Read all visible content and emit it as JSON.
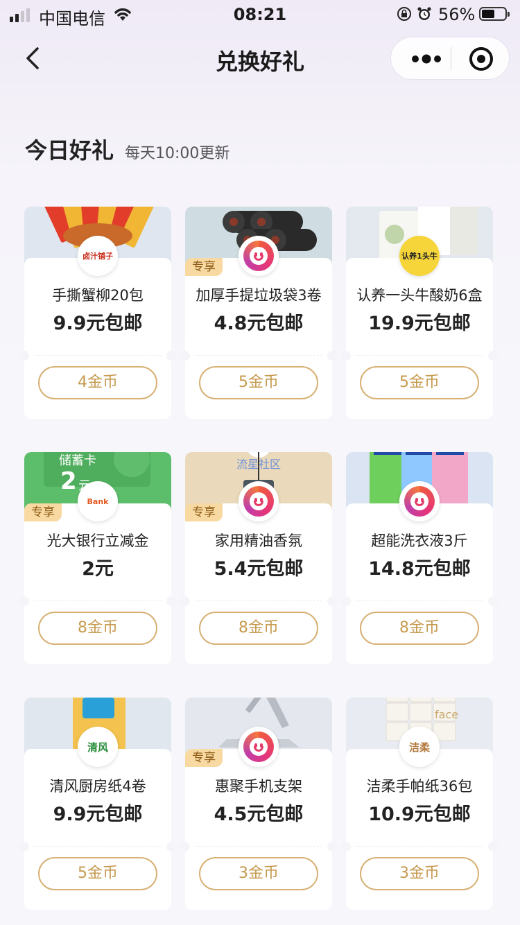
{
  "status_bar": {
    "carrier": "中国电信",
    "time": "08:21",
    "battery": "56%",
    "battery_level": 0.56
  },
  "nav": {
    "title": "兑换好礼"
  },
  "section": {
    "title": "今日好礼",
    "subtitle": "每天10:00更新"
  },
  "products": [
    {
      "name": "手撕蟹柳20包",
      "price": "9.9元包邮",
      "coins": "4金币",
      "badge": "",
      "bg": "#dfe6ef",
      "logo": "lujiangfu-brand-logo",
      "logo_text": "卤汁铺子"
    },
    {
      "name": "加厚手提垃圾袋3卷",
      "price": "4.8元包邮",
      "coins": "5金币",
      "badge": "专享",
      "bg": "#cfdde2",
      "logo": "huiju-logo"
    },
    {
      "name": "认养一头牛酸奶6盒",
      "price": "19.9元包邮",
      "coins": "5金币",
      "badge": "",
      "bg": "#e4e8ef",
      "logo": "renyang-cow-logo",
      "logo_text": "认养1头牛"
    },
    {
      "name": "光大银行立减金",
      "price": "2元",
      "coins": "8金币",
      "badge": "专享",
      "bg": "#5cbd6b",
      "logo": "bank-logo",
      "logo_text": "Bank",
      "voucher_label": "储蓄卡",
      "voucher_amount": "2",
      "voucher_unit": "元"
    },
    {
      "name": "家用精油香氛",
      "price": "5.4元包邮",
      "coins": "8金币",
      "badge": "专享",
      "bg": "#ead9bb",
      "logo": "huiju-logo",
      "overlay_text": "流星社区"
    },
    {
      "name": "超能洗衣液3斤",
      "price": "14.8元包邮",
      "coins": "8金币",
      "badge": "",
      "bg": "#dbe4f3",
      "logo": "huiju-logo"
    },
    {
      "name": "清风厨房纸4卷",
      "price": "9.9元包邮",
      "coins": "5金币",
      "badge": "",
      "bg": "#e1e7ef",
      "logo": "qingfeng-logo",
      "logo_text": "清风"
    },
    {
      "name": "惠聚手机支架",
      "price": "4.5元包邮",
      "coins": "3金币",
      "badge": "专享",
      "bg": "#e4e7ee",
      "logo": "huiju-logo"
    },
    {
      "name": "洁柔手帕纸36包",
      "price": "10.9元包邮",
      "coins": "3金币",
      "badge": "",
      "bg": "#e8ebf1",
      "logo": "jierou-logo",
      "logo_text": "洁柔"
    }
  ]
}
